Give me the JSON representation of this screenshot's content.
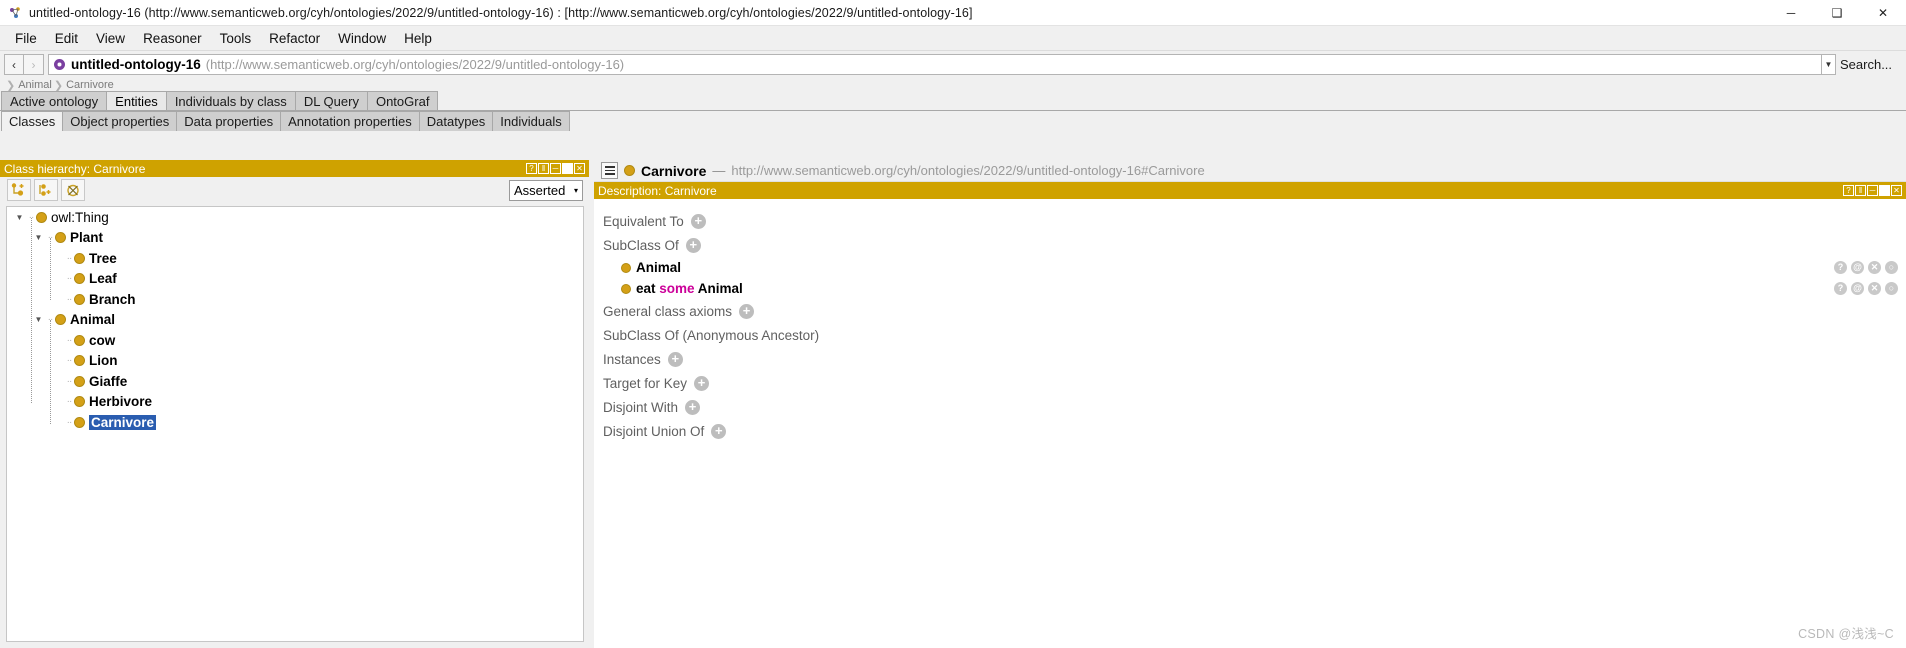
{
  "window": {
    "title": "untitled-ontology-16 (http://www.semanticweb.org/cyh/ontologies/2022/9/untitled-ontology-16)  : [http://www.semanticweb.org/cyh/ontologies/2022/9/untitled-ontology-16]",
    "minimize": "─",
    "maximize": "❑",
    "close": "✕"
  },
  "menubar": {
    "items": [
      {
        "label": "File"
      },
      {
        "label": "Edit"
      },
      {
        "label": "View"
      },
      {
        "label": "Reasoner"
      },
      {
        "label": "Tools"
      },
      {
        "label": "Refactor"
      },
      {
        "label": "Window"
      },
      {
        "label": "Help"
      }
    ]
  },
  "uribar": {
    "back": "‹",
    "forward": "›",
    "ontology_name": "untitled-ontology-16",
    "ontology_uri": "(http://www.semanticweb.org/cyh/ontologies/2022/9/untitled-ontology-16)",
    "dropdown_caret": "▼",
    "search_label": "Search..."
  },
  "breadcrumb": {
    "sep": "❯",
    "items": [
      {
        "label": "Animal"
      },
      {
        "label": "Carnivore"
      }
    ]
  },
  "top_tabs": [
    {
      "label": "Active ontology",
      "active": false
    },
    {
      "label": "Entities",
      "active": true
    },
    {
      "label": "Individuals by class",
      "active": false
    },
    {
      "label": "DL Query",
      "active": false
    },
    {
      "label": "OntoGraf",
      "active": false
    }
  ],
  "sub_tabs": [
    {
      "label": "Classes",
      "active": true
    },
    {
      "label": "Object properties",
      "active": false
    },
    {
      "label": "Data properties",
      "active": false
    },
    {
      "label": "Annotation properties",
      "active": false
    },
    {
      "label": "Datatypes",
      "active": false
    },
    {
      "label": "Individuals",
      "active": false
    }
  ],
  "class_hierarchy": {
    "panel_title": "Class hierarchy: Carnivore",
    "panel_controls": [
      "?",
      "‖",
      "─",
      "■",
      "✕"
    ],
    "toolbar": {
      "add_subclass_label": "add-subclass",
      "add_sibling_class_label": "add-sibling-class",
      "delete_class_label": "delete-class"
    },
    "view_mode": "Asserted",
    "view_mode_caret": "▾",
    "tree": [
      {
        "label": "owl:Thing",
        "depth": 0,
        "expanded": true,
        "bold": false,
        "selected": false
      },
      {
        "label": "Plant",
        "depth": 1,
        "expanded": true,
        "bold": true,
        "selected": false
      },
      {
        "label": "Tree",
        "depth": 2,
        "expanded": null,
        "bold": true,
        "selected": false
      },
      {
        "label": "Leaf",
        "depth": 2,
        "expanded": null,
        "bold": true,
        "selected": false
      },
      {
        "label": "Branch",
        "depth": 2,
        "expanded": null,
        "bold": true,
        "selected": false
      },
      {
        "label": "Animal",
        "depth": 1,
        "expanded": true,
        "bold": true,
        "selected": false
      },
      {
        "label": "cow",
        "depth": 2,
        "expanded": null,
        "bold": true,
        "selected": false
      },
      {
        "label": "Lion",
        "depth": 2,
        "expanded": null,
        "bold": true,
        "selected": false
      },
      {
        "label": "Giaffe",
        "depth": 2,
        "expanded": null,
        "bold": true,
        "selected": false
      },
      {
        "label": "Herbivore",
        "depth": 2,
        "expanded": null,
        "bold": true,
        "selected": false
      },
      {
        "label": "Carnivore",
        "depth": 2,
        "expanded": null,
        "bold": true,
        "selected": true
      }
    ]
  },
  "entity_header": {
    "menu_icon": "hamburger-icon",
    "name": "Carnivore",
    "dash": "—",
    "uri": "http://www.semanticweb.org/cyh/ontologies/2022/9/untitled-ontology-16#Carnivore"
  },
  "description": {
    "panel_title": "Description: Carnivore",
    "panel_controls": [
      "?",
      "‖",
      "─",
      "■",
      "✕"
    ],
    "plus": "+",
    "row_actions": [
      "?",
      "@",
      "✕",
      "○"
    ],
    "sections": [
      {
        "title": "Equivalent To",
        "has_add": true,
        "rows": []
      },
      {
        "title": "SubClass Of",
        "has_add": true,
        "rows": [
          {
            "parts": [
              {
                "text": "Animal",
                "kw": false
              }
            ]
          },
          {
            "parts": [
              {
                "text": "eat ",
                "kw": false
              },
              {
                "text": "some",
                "kw": true
              },
              {
                "text": " Animal",
                "kw": false
              }
            ]
          }
        ]
      },
      {
        "title": "General class axioms",
        "has_add": true,
        "rows": []
      },
      {
        "title": "SubClass Of (Anonymous Ancestor)",
        "has_add": false,
        "rows": []
      },
      {
        "title": "Instances",
        "has_add": true,
        "rows": []
      },
      {
        "title": "Target for Key",
        "has_add": true,
        "rows": []
      },
      {
        "title": "Disjoint With",
        "has_add": true,
        "rows": []
      },
      {
        "title": "Disjoint Union Of",
        "has_add": true,
        "rows": []
      }
    ]
  },
  "watermark": {
    "text": "CSDN @浅浅~C"
  },
  "colors": {
    "panel_header": "#cfa200",
    "class_dot": "#d4a017",
    "selection": "#2a5db0",
    "keyword": "#cc0099"
  }
}
